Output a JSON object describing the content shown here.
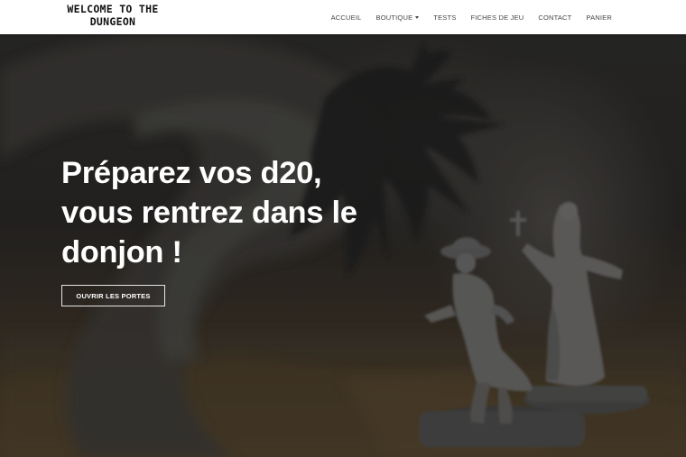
{
  "header": {
    "logo_line1": "WELCOME TO THE",
    "logo_line2": "DUNGEON",
    "nav": [
      {
        "label": "ACCUEIL"
      },
      {
        "label": "BOUTIQUE",
        "has_dropdown": true
      },
      {
        "label": "TESTS"
      },
      {
        "label": "FICHES DE JEU"
      },
      {
        "label": "CONTACT"
      },
      {
        "label": "PANIER"
      }
    ]
  },
  "hero": {
    "title_line1": "Préparez vos d20,",
    "title_line2": "vous rentrez dans le",
    "title_line3": "donjon !",
    "cta_label": "OUVRIR LES PORTES",
    "background_image": "dark photo of tabletop miniatures with a tentacle monster"
  },
  "colors": {
    "navbar_bg": "#ffffff",
    "nav_text": "#444444",
    "hero_text": "#ffffff",
    "button_border": "#e6e6e6"
  }
}
